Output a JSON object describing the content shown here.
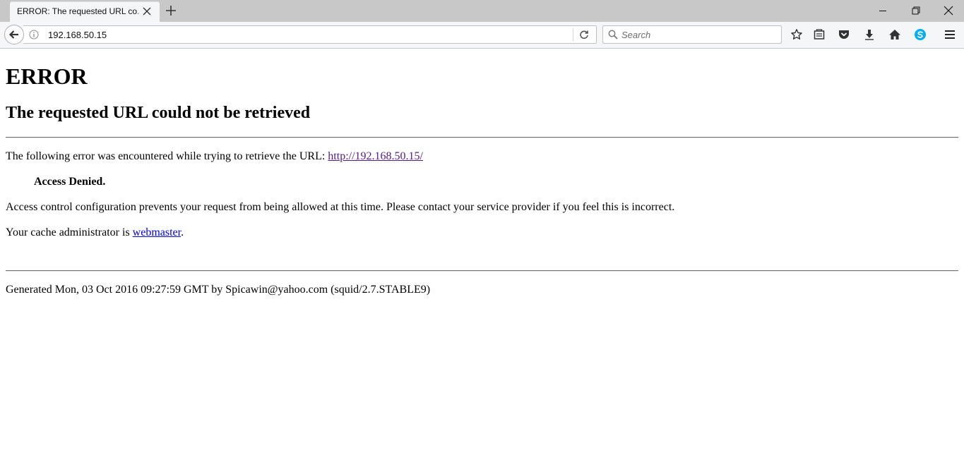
{
  "browser": {
    "tab": {
      "title": "ERROR: The requested URL co..."
    },
    "url": "192.168.50.15",
    "search_placeholder": "Search"
  },
  "icons": {
    "tab_close": "close-icon",
    "new_tab": "plus-icon",
    "minimize": "minimize-icon",
    "restore": "restore-icon",
    "close_window": "close-icon",
    "back": "arrow-left-icon",
    "site_info": "info-icon",
    "reload": "reload-icon",
    "search": "search-icon",
    "bookmark": "star-icon",
    "reading_list": "library-icon",
    "pocket": "pocket-icon",
    "downloads": "download-icon",
    "home": "home-icon",
    "skype": "skype-icon",
    "menu": "hamburger-menu-icon"
  },
  "colors": {
    "skype": "#00aff0",
    "visited_link": "#551a8b",
    "link": "#0000ee"
  },
  "page": {
    "title": "ERROR",
    "subtitle": "The requested URL could not be retrieved",
    "error_intro": "The following error was encountered while trying to retrieve the URL: ",
    "error_url": "http://192.168.50.15/",
    "error_name": "Access Denied.",
    "error_description": "Access control configuration prevents your request from being allowed at this time. Please contact your service provider if you feel this is incorrect.",
    "admin_prefix": "Your cache administrator is ",
    "admin_link": "webmaster",
    "admin_suffix": ".",
    "footer": "Generated Mon, 03 Oct 2016 09:27:59 GMT by Spicawin@yahoo.com (squid/2.7.STABLE9)"
  }
}
